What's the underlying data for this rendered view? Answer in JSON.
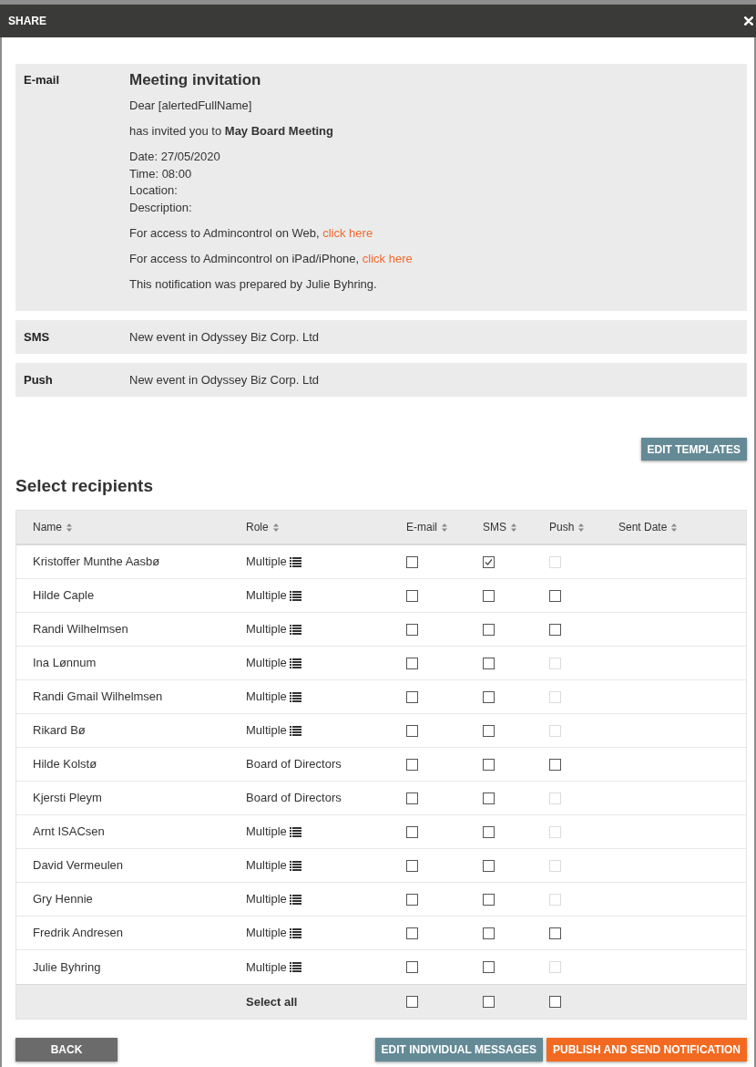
{
  "dialog": {
    "title": "SHARE"
  },
  "templates": [
    {
      "channel": "E-mail",
      "kind": "email",
      "subject": "Meeting invitation",
      "paragraphs": [
        {
          "lines": [
            "Dear [alertedFullName]"
          ]
        },
        {
          "lines": [
            "has invited you to **May Board Meeting**"
          ]
        },
        {
          "lines": [
            "Date: 27/05/2020",
            "Time: 08:00",
            "Location:",
            "Description:"
          ]
        },
        {
          "lines": [
            "For access to Admincontrol on Web,"
          ],
          "link": "click here"
        },
        {
          "lines": [
            "For access to Admincontrol on iPad/iPhone,"
          ],
          "link": "click here"
        },
        {
          "lines": [
            "This notification was prepared by Julie Byhring."
          ]
        }
      ]
    },
    {
      "channel": "SMS",
      "kind": "text",
      "body": "New event in Odyssey Biz Corp. Ltd"
    },
    {
      "channel": "Push",
      "kind": "text",
      "body": "New event in Odyssey Biz Corp. Ltd"
    }
  ],
  "edit_templates_button": "EDIT TEMPLATES",
  "recipients": {
    "heading": "Select recipients",
    "columns": [
      "Name",
      "Role",
      "E-mail",
      "SMS",
      "Push",
      "Sent Date"
    ],
    "rows": [
      {
        "name": "Kristoffer Munthe Aasbø",
        "role": "Multiple",
        "role_list": true,
        "email": {
          "checked": false,
          "disabled": false
        },
        "sms": {
          "checked": true,
          "disabled": false
        },
        "push": {
          "checked": false,
          "disabled": true
        }
      },
      {
        "name": "Hilde Caple",
        "role": "Multiple",
        "role_list": true,
        "email": {
          "checked": false,
          "disabled": false
        },
        "sms": {
          "checked": false,
          "disabled": false
        },
        "push": {
          "checked": false,
          "disabled": false
        }
      },
      {
        "name": "Randi Wilhelmsen",
        "role": "Multiple",
        "role_list": true,
        "email": {
          "checked": false,
          "disabled": false
        },
        "sms": {
          "checked": false,
          "disabled": false
        },
        "push": {
          "checked": false,
          "disabled": false
        }
      },
      {
        "name": "Ina Lønnum",
        "role": "Multiple",
        "role_list": true,
        "email": {
          "checked": false,
          "disabled": false
        },
        "sms": {
          "checked": false,
          "disabled": false
        },
        "push": {
          "checked": false,
          "disabled": true
        }
      },
      {
        "name": "Randi Gmail Wilhelmsen",
        "role": "Multiple",
        "role_list": true,
        "email": {
          "checked": false,
          "disabled": false
        },
        "sms": {
          "checked": false,
          "disabled": false
        },
        "push": {
          "checked": false,
          "disabled": true
        }
      },
      {
        "name": "Rikard Bø",
        "role": "Multiple",
        "role_list": true,
        "email": {
          "checked": false,
          "disabled": false
        },
        "sms": {
          "checked": false,
          "disabled": false
        },
        "push": {
          "checked": false,
          "disabled": true
        }
      },
      {
        "name": "Hilde Kolstø",
        "role": "Board of Directors",
        "role_list": false,
        "email": {
          "checked": false,
          "disabled": false
        },
        "sms": {
          "checked": false,
          "disabled": false
        },
        "push": {
          "checked": false,
          "disabled": false
        }
      },
      {
        "name": "Kjersti Pleym",
        "role": "Board of Directors",
        "role_list": false,
        "email": {
          "checked": false,
          "disabled": false
        },
        "sms": {
          "checked": false,
          "disabled": false
        },
        "push": {
          "checked": false,
          "disabled": true
        }
      },
      {
        "name": "Arnt ISACsen",
        "role": "Multiple",
        "role_list": true,
        "email": {
          "checked": false,
          "disabled": false
        },
        "sms": {
          "checked": false,
          "disabled": false
        },
        "push": {
          "checked": false,
          "disabled": true
        }
      },
      {
        "name": "David Vermeulen",
        "role": "Multiple",
        "role_list": true,
        "email": {
          "checked": false,
          "disabled": false
        },
        "sms": {
          "checked": false,
          "disabled": false
        },
        "push": {
          "checked": false,
          "disabled": true
        }
      },
      {
        "name": "Gry Hennie",
        "role": "Multiple",
        "role_list": true,
        "email": {
          "checked": false,
          "disabled": false
        },
        "sms": {
          "checked": false,
          "disabled": false
        },
        "push": {
          "checked": false,
          "disabled": true
        }
      },
      {
        "name": "Fredrik Andresen",
        "role": "Multiple",
        "role_list": true,
        "email": {
          "checked": false,
          "disabled": false
        },
        "sms": {
          "checked": false,
          "disabled": false
        },
        "push": {
          "checked": false,
          "disabled": false
        }
      },
      {
        "name": "Julie Byhring",
        "role": "Multiple",
        "role_list": true,
        "email": {
          "checked": false,
          "disabled": false
        },
        "sms": {
          "checked": false,
          "disabled": false
        },
        "push": {
          "checked": false,
          "disabled": true
        }
      }
    ],
    "select_all": {
      "label": "Select all",
      "email": {
        "checked": false,
        "disabled": false
      },
      "sms": {
        "checked": false,
        "disabled": false
      },
      "push": {
        "checked": false,
        "disabled": false
      }
    }
  },
  "buttons": [
    {
      "label": "BACK",
      "kind": "secondary"
    },
    {
      "label": "EDIT INDIVIDUAL MESSAGES",
      "kind": "info"
    },
    {
      "label": "PUBLISH AND SEND NOTIFICATION",
      "kind": "primary"
    }
  ]
}
